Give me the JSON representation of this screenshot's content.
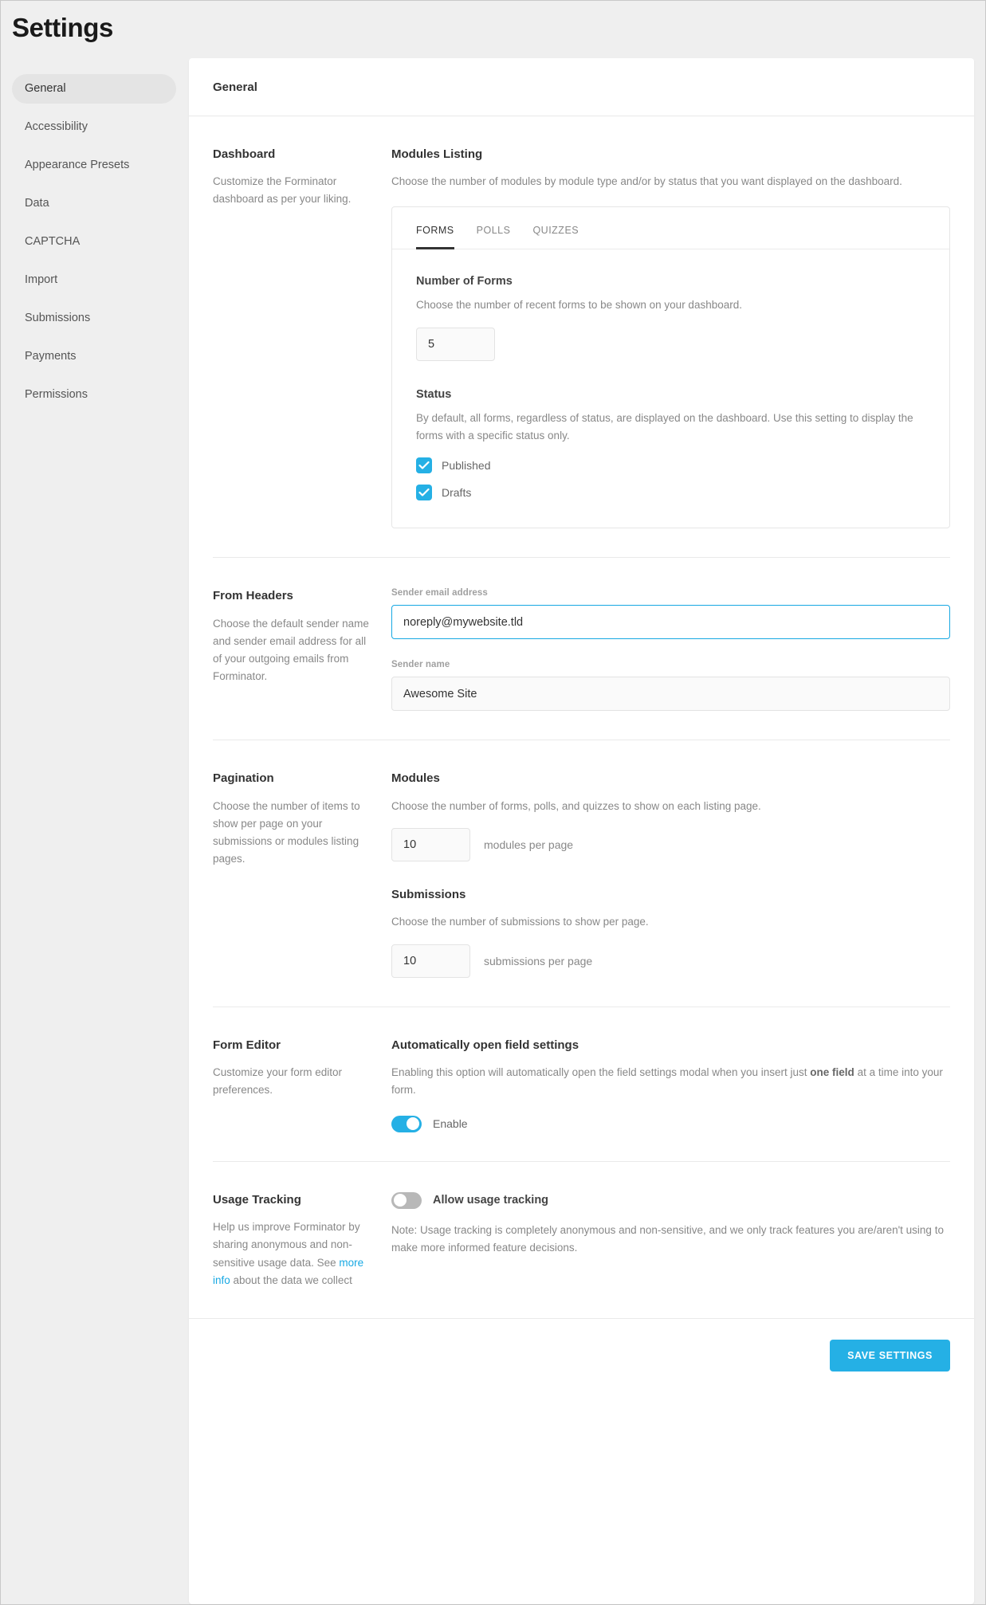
{
  "header": {
    "title": "Settings"
  },
  "sidebar": {
    "items": [
      {
        "label": "General",
        "active": true
      },
      {
        "label": "Accessibility",
        "active": false
      },
      {
        "label": "Appearance Presets",
        "active": false
      },
      {
        "label": "Data",
        "active": false
      },
      {
        "label": "CAPTCHA",
        "active": false
      },
      {
        "label": "Import",
        "active": false
      },
      {
        "label": "Submissions",
        "active": false
      },
      {
        "label": "Payments",
        "active": false
      },
      {
        "label": "Permissions",
        "active": false
      }
    ]
  },
  "card": {
    "title": "General"
  },
  "sections": {
    "dashboard": {
      "title": "Dashboard",
      "desc": "Customize the Forminator dashboard as per your liking.",
      "modules_listing": {
        "title": "Modules Listing",
        "desc": "Choose the number of modules by module type and/or by status that you want displayed on the dashboard.",
        "tabs": [
          {
            "label": "FORMS",
            "active": true
          },
          {
            "label": "POLLS",
            "active": false
          },
          {
            "label": "QUIZZES",
            "active": false
          }
        ],
        "number_of_forms": {
          "title": "Number of Forms",
          "desc": "Choose the number of recent forms to be shown on your dashboard.",
          "value": "5"
        },
        "status": {
          "title": "Status",
          "desc": "By default, all forms, regardless of status, are displayed on the dashboard. Use this setting to display the forms with a specific status only.",
          "options": [
            {
              "label": "Published",
              "checked": true
            },
            {
              "label": "Drafts",
              "checked": true
            }
          ]
        }
      }
    },
    "from_headers": {
      "title": "From Headers",
      "desc": "Choose the default sender name and sender email address for all of your outgoing emails from Forminator.",
      "sender_email": {
        "label": "Sender email address",
        "value": "noreply@mywebsite.tld",
        "placeholder": "noreply@mywebsite.tld"
      },
      "sender_name": {
        "label": "Sender name",
        "value": "Awesome Site",
        "placeholder": "Awesome Site"
      }
    },
    "pagination": {
      "title": "Pagination",
      "desc": "Choose the number of items to show per page on your submissions or modules listing pages.",
      "modules": {
        "title": "Modules",
        "desc": "Choose the number of forms, polls, and quizzes to show on each listing page.",
        "value": "10",
        "suffix": "modules per page"
      },
      "submissions": {
        "title": "Submissions",
        "desc": "Choose the number of submissions to show per page.",
        "value": "10",
        "suffix": "submissions per page"
      }
    },
    "form_editor": {
      "title": "Form Editor",
      "desc": "Customize your form editor preferences.",
      "auto_open": {
        "title": "Automatically open field settings",
        "desc_before": "Enabling this option will automatically open the field settings modal when you insert just ",
        "desc_bold": "one field",
        "desc_after": " at a time into your form.",
        "toggle_label": "Enable",
        "enabled": true
      }
    },
    "usage_tracking": {
      "title": "Usage Tracking",
      "desc_before": "Help us improve Forminator by sharing anonymous and non-sensitive usage data. See ",
      "desc_link": "more info",
      "desc_after": " about the data we collect",
      "toggle_label": "Allow usage tracking",
      "enabled": false,
      "note": "Note: Usage tracking is completely anonymous and non-sensitive, and we only track features you are/aren't using to make more informed feature decisions."
    }
  },
  "footer": {
    "save_label": "SAVE SETTINGS"
  },
  "colors": {
    "accent": "#25b0e5",
    "link": "#17a8e3",
    "page_bg": "#efefef",
    "toggle_off": "#b8b8b8"
  }
}
